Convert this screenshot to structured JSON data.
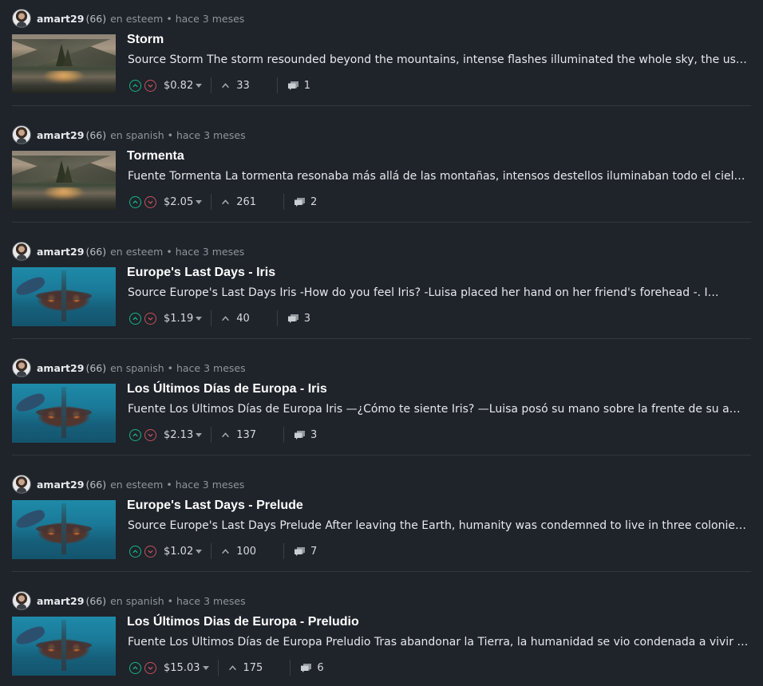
{
  "posts": [
    {
      "author": "amart29",
      "reputation": "(66)",
      "community": "en esteem",
      "time": "hace 3 meses",
      "title": "Storm",
      "excerpt": "Source Storm The storm resounded beyond the mountains, intense flashes illuminated the whole sky, the usually…",
      "payout": "$0.82",
      "votes": "33",
      "comments": "1",
      "thumbnail": "storm"
    },
    {
      "author": "amart29",
      "reputation": "(66)",
      "community": "en spanish",
      "time": "hace 3 meses",
      "title": "Tormenta",
      "excerpt": "Fuente Tormenta La tormenta resonaba más allá de las montañas, intensos destellos iluminaban todo el cielo, el…",
      "payout": "$2.05",
      "votes": "261",
      "comments": "2",
      "thumbnail": "storm"
    },
    {
      "author": "amart29",
      "reputation": "(66)",
      "community": "en esteem",
      "time": "hace 3 meses",
      "title": "Europe's Last Days - Iris",
      "excerpt": "Source Europe's Last Days Iris -How do you feel Iris? -Luisa placed her hand on her friend's forehead -. I…",
      "payout": "$1.19",
      "votes": "40",
      "comments": "3",
      "thumbnail": "europe"
    },
    {
      "author": "amart29",
      "reputation": "(66)",
      "community": "en spanish",
      "time": "hace 3 meses",
      "title": "Los Últimos Días de Europa - Iris",
      "excerpt": "Fuente Los Últimos Días de Europa Iris —¿Cómo te siente Iris? —Luisa posó su mano sobre la frente de su amiga —…",
      "payout": "$2.13",
      "votes": "137",
      "comments": "3",
      "thumbnail": "europe"
    },
    {
      "author": "amart29",
      "reputation": "(66)",
      "community": "en esteem",
      "time": "hace 3 meses",
      "title": "Europe's Last Days - Prelude",
      "excerpt": "Source Europe's Last Days Prelude After leaving the Earth, humanity was condemned to live in three colonies…",
      "payout": "$1.02",
      "votes": "100",
      "comments": "7",
      "thumbnail": "europe"
    },
    {
      "author": "amart29",
      "reputation": "(66)",
      "community": "en spanish",
      "time": "hace 3 meses",
      "title": "Los Últimos Dias de Europa - Preludio",
      "excerpt": "Fuente Los Últimos Días de Europa Preludio Tras abandonar la Tierra, la humanidad se vio condenada a vivir en…",
      "payout": "$15.03",
      "votes": "175",
      "comments": "6",
      "thumbnail": "europe"
    }
  ],
  "colors": {
    "background": "#1f232a",
    "upvote": "#16b487",
    "downvote": "#c7505c",
    "separator": "#33383f"
  }
}
